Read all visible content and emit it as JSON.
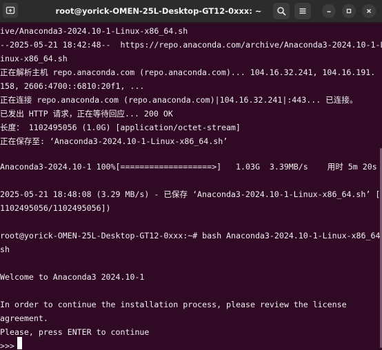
{
  "window": {
    "title": "root@yorick-OMEN-25L-Desktop-GT12-0xxx: ~"
  },
  "icons": {
    "new_tab": "new-tab-icon",
    "search": "search-icon",
    "menu": "hamburger-menu-icon",
    "minimize": "minimize-icon",
    "maximize": "maximize-icon",
    "close": "close-icon"
  },
  "colors": {
    "terminal_bg": "#300a24",
    "titlebar_bg": "#2c2c2c",
    "text": "#f0f0f0"
  },
  "terminal": {
    "lines": [
      "ive/Anaconda3-2024.10-1-Linux-x86_64.sh",
      "--2025-05-21 18:42:48--  https://repo.anaconda.com/archive/Anaconda3-2024.10-1-L",
      "inux-x86_64.sh",
      "正在解析主机 repo.anaconda.com (repo.anaconda.com)... 104.16.32.241, 104.16.191.",
      "158, 2606:4700::6810:20f1, ...",
      "正在连接 repo.anaconda.com (repo.anaconda.com)|104.16.32.241|:443... 已连接。",
      "已发出 HTTP 请求，正在等待回应... 200 OK",
      "长度： 1102495056 (1.0G) [application/octet-stream]",
      "正在保存至: ‘Anaconda3-2024.10-1-Linux-x86_64.sh’",
      "",
      "Anaconda3-2024.10-1 100%[===================>]   1.03G  3.39MB/s    用时 5m 20s",
      "",
      "2025-05-21 18:48:08 (3.29 MB/s) - 已保存 ‘Anaconda3-2024.10-1-Linux-x86_64.sh’ [",
      "1102495056/1102495056])",
      "",
      "root@yorick-OMEN-25L-Desktop-GT12-0xxx:~# bash Anaconda3-2024.10-1-Linux-x86_64.",
      "sh",
      "",
      "Welcome to Anaconda3 2024.10-1",
      "",
      "In order to continue the installation process, please review the license",
      "agreement.",
      "Please, press ENTER to continue",
      ">>> "
    ]
  }
}
